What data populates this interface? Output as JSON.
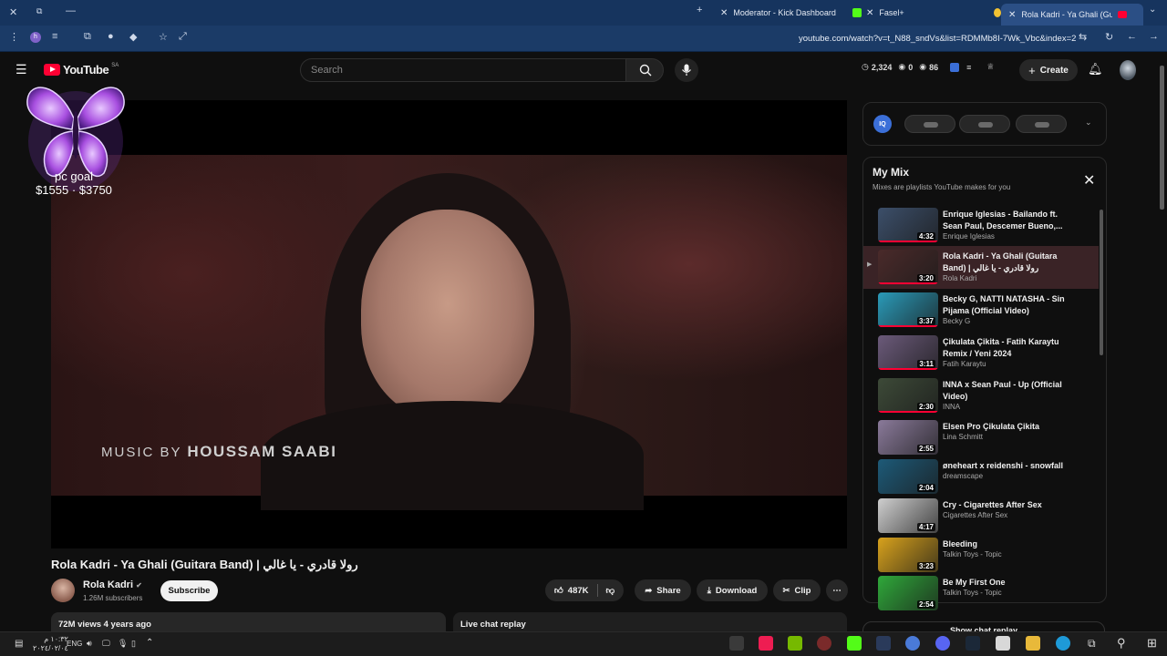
{
  "browser": {
    "tabs": [
      {
        "title": "Moderator - Kick Dashboard"
      },
      {
        "title": "Fasel+"
      },
      {
        "title": "Rola Kadri - Ya Ghali (Guitar"
      }
    ],
    "url": "youtube.com/watch?v=t_N88_sndVs&list=RDMMb8I-7Wk_Vbc&index=2"
  },
  "youtube": {
    "logo_text": "YouTube",
    "logo_region": "SA",
    "search_placeholder": "Search",
    "stats": {
      "count1": "2,324",
      "count2": "0",
      "count3": "86"
    },
    "create_label": "Create"
  },
  "overlay": {
    "goal_label": "pc goal",
    "goal_amount": "$1555 · $3750"
  },
  "video": {
    "watermark_prefix": "MUSIC BY",
    "watermark_name": "HOUSSAM SAABI",
    "title": "Rola Kadri - Ya Ghali (Guitara Band) | رولا قادري - يا غالي",
    "channel": "Rola Kadri",
    "subscribers": "1.26M subscribers",
    "subscribe_label": "Subscribe",
    "likes": "487K",
    "share_label": "Share",
    "download_label": "Download",
    "clip_label": "Clip",
    "views_date": "72M views  4 years ago",
    "live_chat_label": "Live chat replay",
    "show_chat_label": "Show chat replay"
  },
  "mix": {
    "title": "My Mix",
    "subtitle": "Mixes are playlists YouTube makes for you",
    "items": [
      {
        "title": "Enrique Iglesias - Bailando ft. Sean Paul, Descemer Bueno,...",
        "channel": "Enrique Iglesias",
        "duration": "4:32",
        "color": "#3c4f6a"
      },
      {
        "title": "Rola Kadri - Ya Ghali (Guitara Band) | رولا قادري - يا غالي",
        "channel": "Rola Kadri",
        "duration": "3:20",
        "color": "#4a2a2a"
      },
      {
        "title": "Becky G, NATTI NATASHA - Sin Pijama (Official Video)",
        "channel": "Becky G",
        "duration": "3:37",
        "color": "#2a9ab8"
      },
      {
        "title": "Çikulata Çikita - Fatih Karaytu Remix / Yeni 2024",
        "channel": "Fatih Karaytu",
        "duration": "3:11",
        "color": "#6b5a7a"
      },
      {
        "title": "INNA x Sean Paul - Up (Official Video)",
        "channel": "INNA",
        "duration": "2:30",
        "color": "#3d4a38"
      },
      {
        "title": "Elsen Pro Çikulata Çikita",
        "channel": "Lina Schmitt",
        "duration": "2:55",
        "color": "#8a7a9a"
      },
      {
        "title": "øneheart x reidenshi - snowfall",
        "channel": "dreamscape",
        "duration": "2:04",
        "color": "#1d5a78"
      },
      {
        "title": "Cry - Cigarettes After Sex",
        "channel": "Cigarettes After Sex",
        "duration": "4:17",
        "color": "#cfcfcf"
      },
      {
        "title": "Bleeding",
        "channel": "Talkin Toys - Topic",
        "duration": "3:23",
        "color": "#d8a21c"
      },
      {
        "title": "Be My First One",
        "channel": "Talkin Toys - Topic",
        "duration": "2:54",
        "color": "#2fa83a"
      }
    ]
  },
  "taskbar": {
    "lang": "ENG",
    "time": "١٠:٣٢ م",
    "date": "٢٠٢٤/٠٢/٠٤"
  }
}
